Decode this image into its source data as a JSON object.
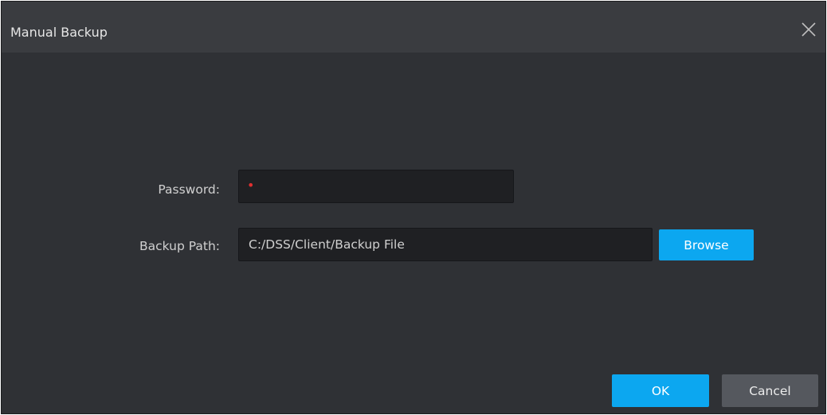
{
  "dialog": {
    "title": "Manual Backup",
    "close_icon": "close-icon"
  },
  "form": {
    "password_label": "Password:",
    "password_mask": "•",
    "backup_path_label": "Backup Path:",
    "backup_path_value": "C:/DSS/Client/Backup File",
    "browse_label": "Browse"
  },
  "footer": {
    "ok_label": "OK",
    "cancel_label": "Cancel"
  },
  "colors": {
    "dialog_bg": "#2f3135",
    "titlebar_bg": "#3a3c40",
    "primary": "#0ca7f0",
    "secondary": "#55585e",
    "password_dot": "#e03030"
  }
}
